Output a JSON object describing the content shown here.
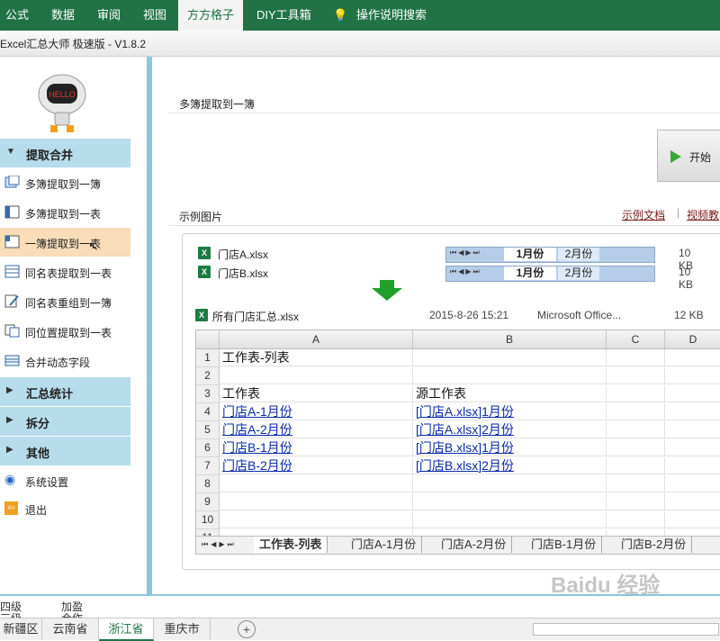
{
  "ribbon": {
    "tabs": [
      "公式",
      "数据",
      "审阅",
      "视图",
      "方方格子",
      "DIY工具箱"
    ],
    "search": "操作说明搜索"
  },
  "window": {
    "title": "Excel汇总大师 极速版 - V1.8.2"
  },
  "sidebar": {
    "robot_text": "HELLO",
    "sections": [
      {
        "label": "提取合并",
        "expanded": true
      },
      {
        "label": "汇总统计",
        "expanded": false
      },
      {
        "label": "拆分",
        "expanded": false
      },
      {
        "label": "其他",
        "expanded": false
      }
    ],
    "items": [
      "多簿提取到一簿",
      "多簿提取到一表",
      "一簿提取到一表",
      "同名表提取到一表",
      "同名表重组到一簿",
      "同位置提取到一表",
      "合并动态字段"
    ],
    "selected_item": "一簿提取到一表",
    "settings": "系统设置",
    "exit": "退出"
  },
  "main": {
    "header": "多簿提取到一簿",
    "start_button": "开始",
    "example_header": "示例图片",
    "links": {
      "doc": "示例文档",
      "video": "视频教"
    },
    "files": [
      {
        "name": "门店A.xlsx",
        "tabs": [
          "1月份",
          "2月份"
        ],
        "size": "10 KB"
      },
      {
        "name": "门店B.xlsx",
        "tabs": [
          "1月份",
          "2月份"
        ],
        "size": "10 KB"
      }
    ],
    "result_file": {
      "name": "所有门店汇总.xlsx",
      "date": "2015-8-26 15:21",
      "type": "Microsoft Office...",
      "size": "12 KB"
    },
    "grid": {
      "columns": [
        "A",
        "B",
        "C",
        "D"
      ],
      "rows": [
        {
          "n": "1",
          "a": "工作表-列表",
          "b": ""
        },
        {
          "n": "2",
          "a": "",
          "b": ""
        },
        {
          "n": "3",
          "a": "工作表",
          "b": "源工作表"
        },
        {
          "n": "4",
          "a": "门店A-1月份",
          "b": "[门店A.xlsx]1月份"
        },
        {
          "n": "5",
          "a": "门店A-2月份",
          "b": "[门店A.xlsx]2月份"
        },
        {
          "n": "6",
          "a": "门店B-1月份",
          "b": "[门店B.xlsx]1月份"
        },
        {
          "n": "7",
          "a": "门店B-2月份",
          "b": "[门店B.xlsx]2月份"
        },
        {
          "n": "8",
          "a": "",
          "b": ""
        },
        {
          "n": "9",
          "a": "",
          "b": ""
        },
        {
          "n": "10",
          "a": "",
          "b": ""
        },
        {
          "n": "11",
          "a": "",
          "b": ""
        }
      ],
      "sheet_tabs": [
        "工作表-列表",
        "门店A-1月份",
        "门店A-2月份",
        "门店B-1月份",
        "门店B-2月份"
      ]
    }
  },
  "bottom": {
    "cells": [
      "四级",
      "加盈",
      "三级",
      "合作"
    ],
    "sheet_tabs": [
      "新疆区",
      "云南省",
      "浙江省",
      "重庆市"
    ],
    "active_tab": "浙江省"
  },
  "watermark": "Baidu 经验"
}
